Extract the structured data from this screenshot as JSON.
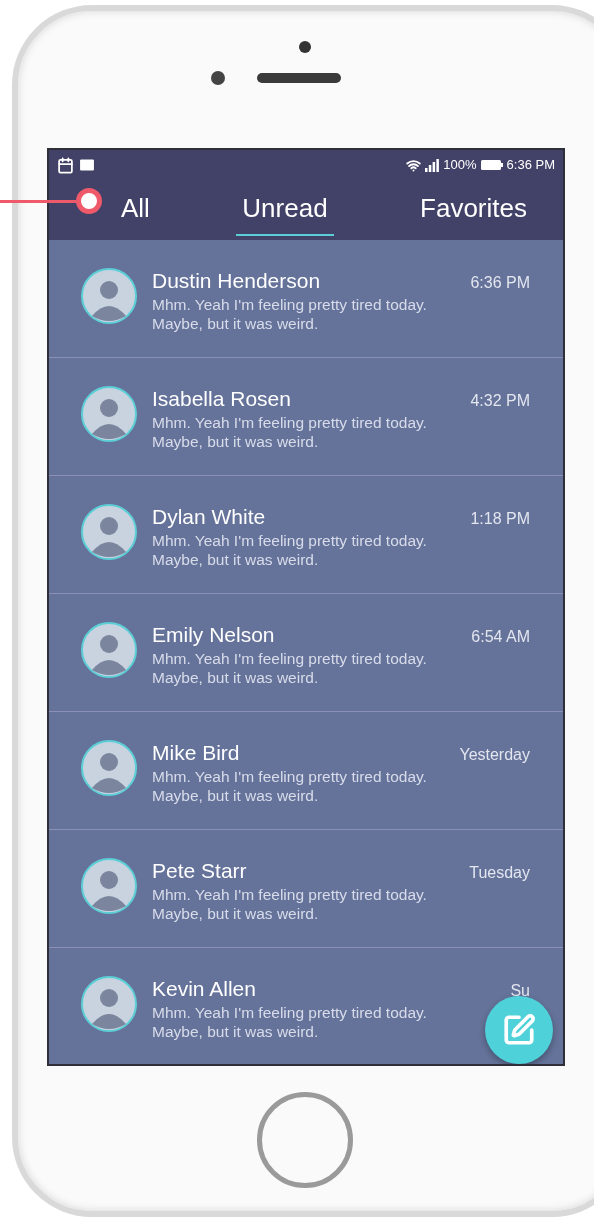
{
  "status_bar": {
    "battery": "100%",
    "time": "6:36 PM"
  },
  "tabs": [
    {
      "label": "All",
      "selected": false
    },
    {
      "label": "Unread",
      "selected": true
    },
    {
      "label": "Favorites",
      "selected": false
    }
  ],
  "conversations": [
    {
      "name": "Dustin Henderson",
      "time": "6:36 PM",
      "lines": [
        "Mhm. Yeah I'm feeling pretty tired today.",
        "Maybe, but it was weird."
      ]
    },
    {
      "name": "Isabella Rosen",
      "time": "4:32 PM",
      "lines": [
        "Mhm. Yeah I'm feeling pretty tired today.",
        "Maybe, but it was weird."
      ]
    },
    {
      "name": "Dylan White",
      "time": "1:18 PM",
      "lines": [
        "Mhm. Yeah I'm feeling pretty tired today.",
        "Maybe, but it was weird."
      ]
    },
    {
      "name": "Emily Nelson",
      "time": "6:54 AM",
      "lines": [
        "Mhm. Yeah I'm feeling pretty tired today.",
        "Maybe, but it was weird."
      ]
    },
    {
      "name": "Mike Bird",
      "time": "Yesterday",
      "lines": [
        "Mhm. Yeah I'm feeling pretty tired today.",
        "Maybe, but it was weird."
      ]
    },
    {
      "name": "Pete Starr",
      "time": "Tuesday",
      "lines": [
        "Mhm. Yeah I'm feeling pretty tired today.",
        "Maybe, but it was weird."
      ]
    },
    {
      "name": "Kevin Allen",
      "time": "Su",
      "lines": [
        "Mhm. Yeah I'm feeling pretty tired today.",
        "Maybe, but it was weird."
      ]
    }
  ]
}
